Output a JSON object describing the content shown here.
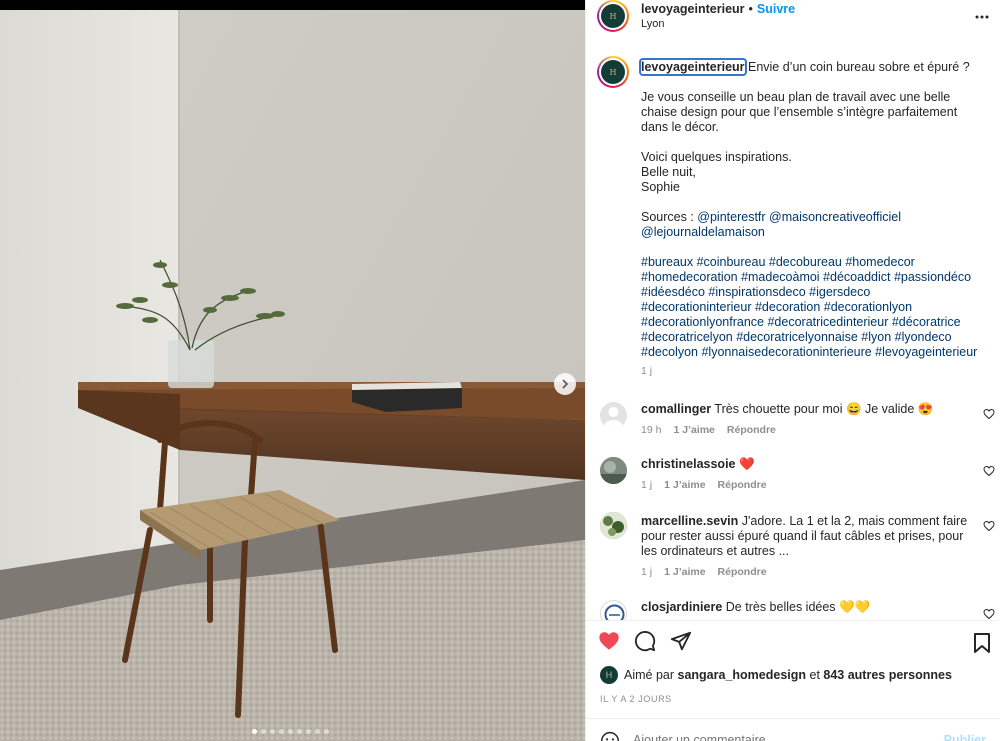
{
  "post": {
    "username": "levoyageinterieur",
    "follow_label": "Suivre",
    "separator": "•",
    "location": "Lyon",
    "more_label": "•••",
    "avatar_text": "H"
  },
  "caption": {
    "username": "levoyageinterieur",
    "first_line": " Envie d’un coin bureau sobre et épuré ?",
    "para2": "Je vous conseille un beau plan de travail avec une belle chaise design pour que l’ensemble s’intègre parfaitement dans le décor.",
    "para3": "Voici quelques inspirations.\nBelle nuit,\nSophie",
    "sources_label": "Sources : ",
    "sources_links": "@pinterestfr @maisoncreativeofficiel @lejournaldelamaison",
    "hashtags": "#bureaux #coinbureau #decobureau #homedecor #homedecoration #madecoàmoi #décoaddict #passiondéco #idéesdéco #inspirationsdeco #igersdeco #decorationinterieur #decoration #decorationlyon #decorationlyonfrance #decoratricedinterieur #décoratrice #decoratricelyon #decoratricelyonnaise #lyon #lyondeco #decolyon #lyonnaisedecorationinterieure #levoyageinterieur",
    "time": "1 j"
  },
  "comments": [
    {
      "user": "comallinger",
      "text": "Très chouette pour moi 😄 Je valide 😍",
      "time": "19 h",
      "likes": "1 J’aime",
      "reply": "Répondre"
    },
    {
      "user": "christinelassoie",
      "text": "❤️",
      "time": "1 j",
      "likes": "1 J’aime",
      "reply": "Répondre"
    },
    {
      "user": "marcelline.sevin",
      "text": "J'adore. La 1 et la 2, mais comment faire pour rester aussi épuré quand il faut câbles et prises, pour les ordinateurs et autres ...",
      "time": "1 j",
      "likes": "1 J’aime",
      "reply": "Répondre"
    },
    {
      "user": "closjardiniere",
      "text": "De très belles idées 💛💛",
      "time": "",
      "likes": "",
      "reply": ""
    }
  ],
  "footer": {
    "liked_prefix": "Aimé par ",
    "liked_user": "sangara_homedesign",
    "liked_and": " et ",
    "liked_others": "843 autres personnes",
    "ago": "IL Y A 2 JOURS",
    "add_comment_placeholder": "Ajouter un commentaire...",
    "publish_label": "Publier"
  },
  "carousel": {
    "dot_count": 9,
    "active_index": 0
  },
  "colors": {
    "link": "#00376b",
    "follow": "#0095f6",
    "heart_liked": "#ed4956",
    "muted": "#8e8e8e",
    "highlight_outline": "#3b73c8"
  }
}
